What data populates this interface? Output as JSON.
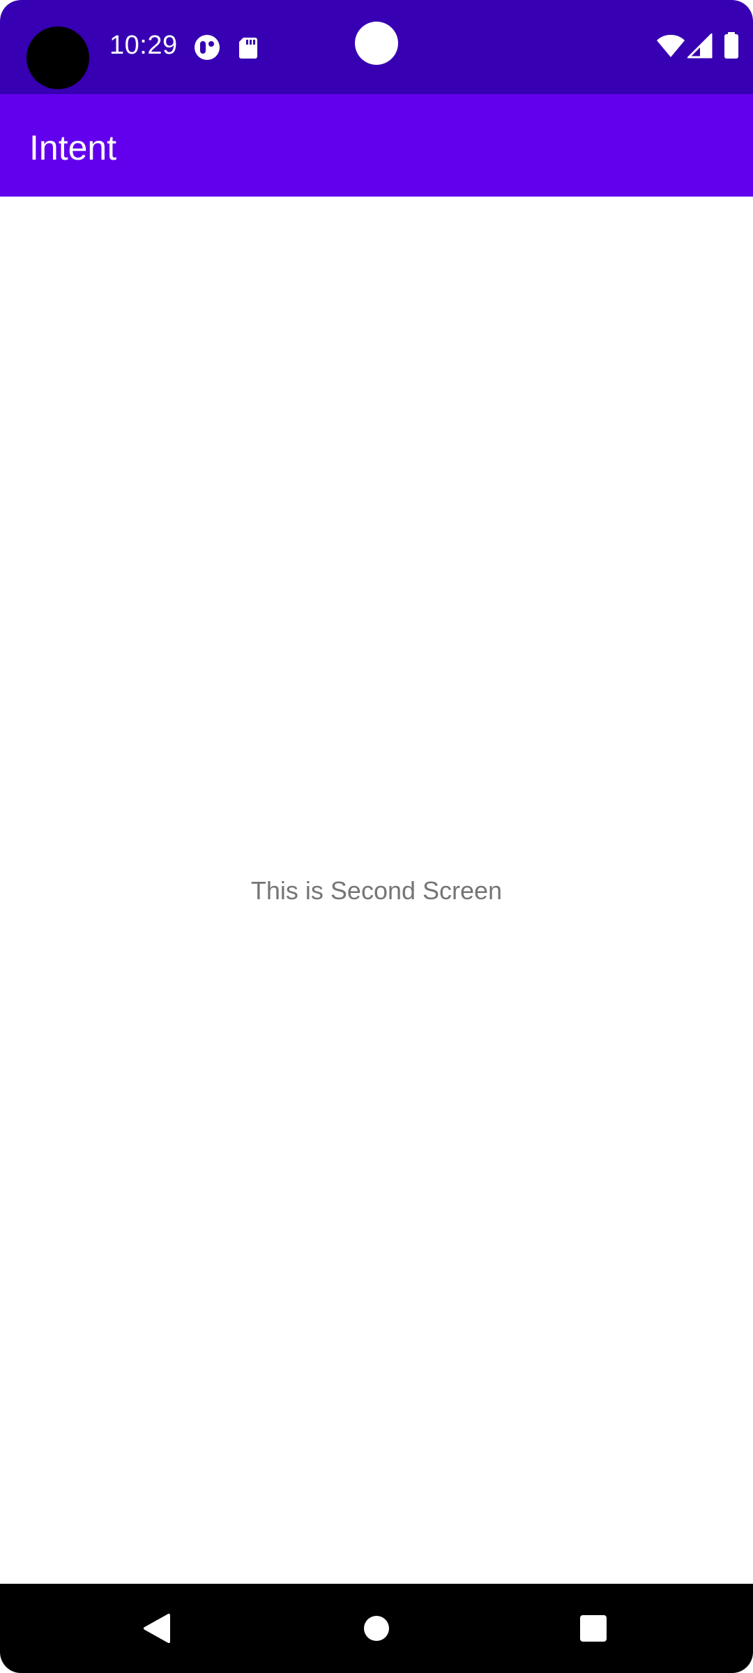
{
  "status_bar": {
    "time": "10:29",
    "icons": [
      "notification-app-icon",
      "sd-card-icon",
      "wifi-icon",
      "cell-signal-icon",
      "battery-icon"
    ],
    "background": "#3700B3"
  },
  "app_bar": {
    "title": "Intent",
    "background": "#6200EE"
  },
  "content": {
    "message": "This is Second Screen",
    "text_color": "#757575"
  },
  "nav_bar": {
    "buttons": [
      "back",
      "home",
      "recents"
    ]
  }
}
